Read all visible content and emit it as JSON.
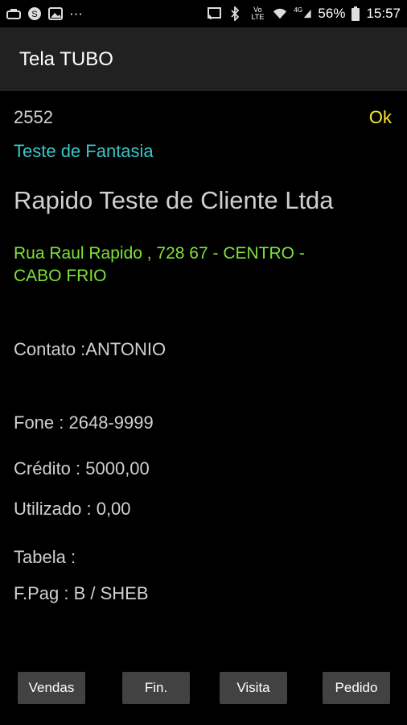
{
  "status_bar": {
    "left_icons": [
      "storage-icon",
      "skype-icon",
      "image-icon",
      "more-icon"
    ],
    "more_glyph": "···",
    "right_icons": [
      "cast-icon",
      "bluetooth-icon",
      "volte-icon",
      "wifi-icon",
      "signal-icon",
      "battery-icon"
    ],
    "volte_label": "Vo LTE",
    "network_label": "4G",
    "battery_percent": "56%",
    "time": "15:57"
  },
  "appbar": {
    "title": "Tela TUBO"
  },
  "client": {
    "code": "2552",
    "status": "Ok",
    "fantasia": "Teste de Fantasia",
    "name": "Rapido Teste de Cliente Ltda",
    "address": "Rua Raul Rapido , 728 67 - CENTRO - CABO FRIO",
    "contato": "Contato :ANTONIO",
    "fone": "Fone : 2648-9999",
    "credito": "Crédito : 5000,00",
    "utilizado": "Utilizado : 0,00",
    "tabela": "Tabela :",
    "fpag": "F.Pag : B / SHEB"
  },
  "buttons": {
    "vendas": "Vendas",
    "fin": "Fin.",
    "visita": "Visita",
    "pedido": "Pedido"
  },
  "colors": {
    "fantasia": "#38c7c7",
    "status": "#ffe633",
    "address": "#7fe03c",
    "appbar": "#212121"
  }
}
